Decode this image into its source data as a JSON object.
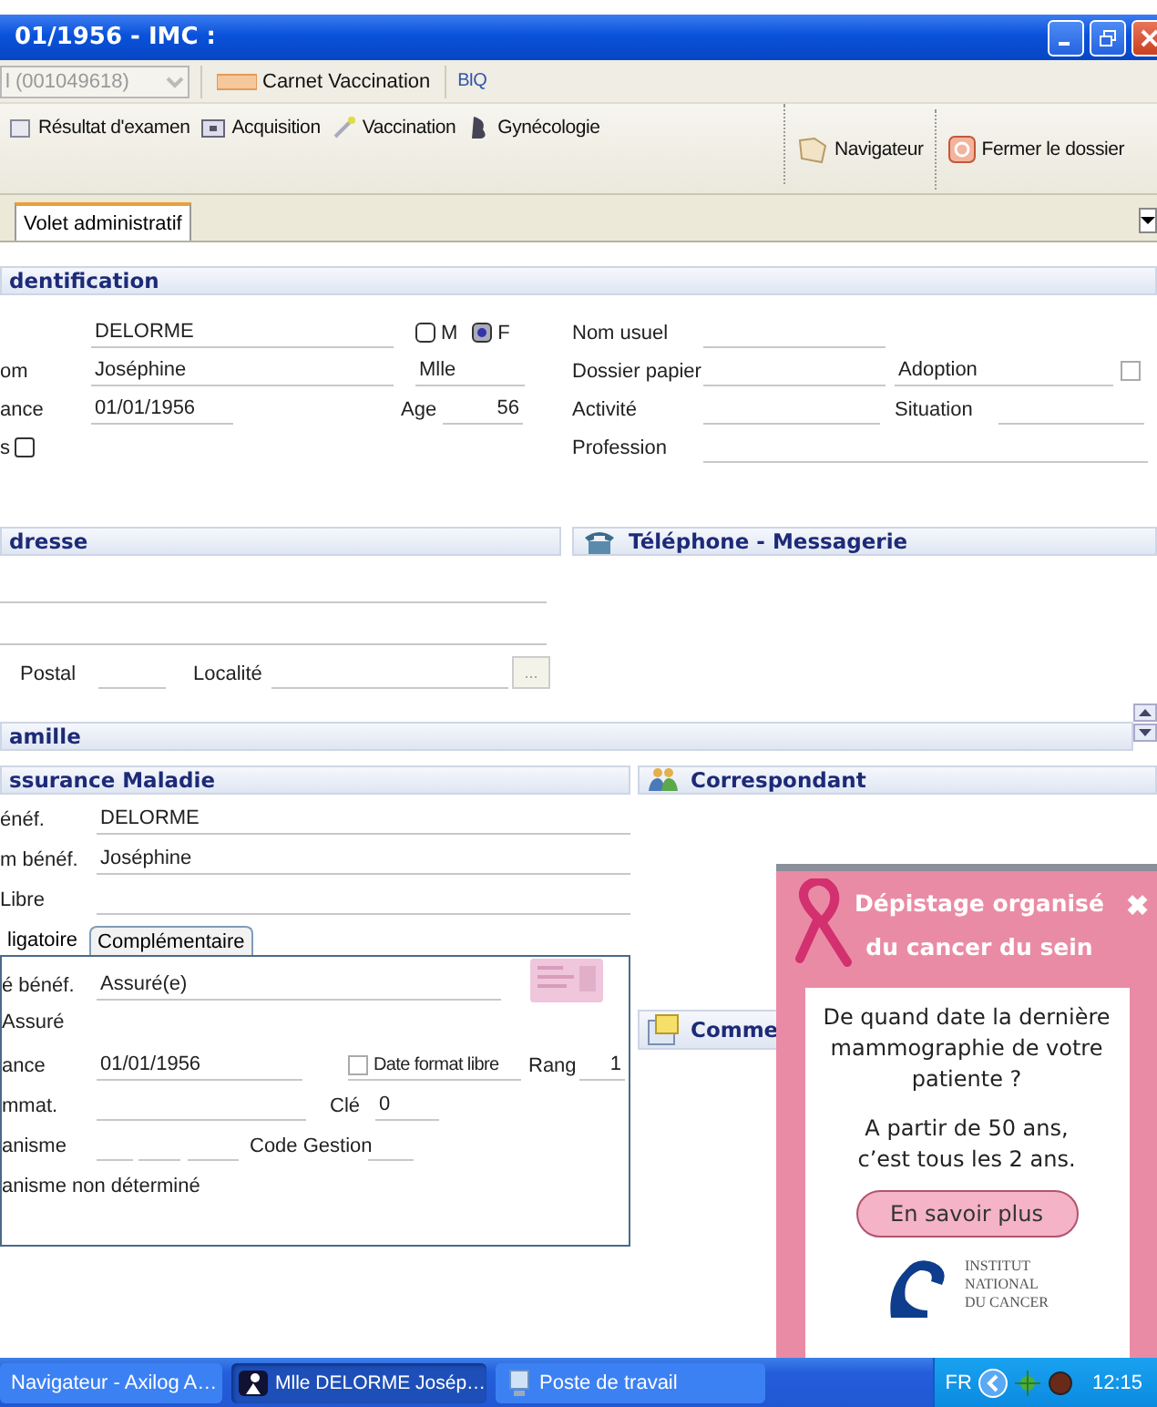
{
  "window": {
    "title": "01/1956 - IMC :"
  },
  "patient_combo": {
    "value": "l (001049618)"
  },
  "top_toolbar": {
    "vaccination_book": "Carnet Vaccination",
    "logo": "BIQ"
  },
  "toolbar": {
    "left": [
      "Résultat d'examen",
      "Acquisition",
      "Vaccination",
      "Gynécologie"
    ],
    "right": [
      "Navigateur",
      "Fermer le dossier"
    ]
  },
  "tabs": [
    {
      "label": "Volet administratif",
      "selected": true
    }
  ],
  "identification": {
    "title": "dentification",
    "last_name": "DELORME",
    "sex": [
      {
        "label": "M",
        "selected": false
      },
      {
        "label": "F",
        "selected": true
      }
    ],
    "first_name": {
      "label": "om",
      "value": "Joséphine"
    },
    "civility": "Mlle",
    "birth_date": {
      "label": "ance",
      "value": "01/01/1956"
    },
    "age": {
      "label": "Age",
      "value": "56"
    },
    "flag": {
      "label": "s",
      "checked": false
    },
    "usual_name": {
      "label": "Nom usuel"
    },
    "paper_file": {
      "label": "Dossier papier"
    },
    "adoption": {
      "label": "Adoption",
      "checked": false
    },
    "activity": {
      "label": "Activité"
    },
    "situation": {
      "label": "Situation"
    },
    "profession": {
      "label": "Profession"
    }
  },
  "address": {
    "title": "dresse",
    "postal": {
      "label": "Postal"
    },
    "city": {
      "label": "Localité"
    },
    "lookup_button": "..."
  },
  "phone": {
    "title": "Téléphone - Messagerie"
  },
  "family": {
    "title": "amille"
  },
  "insurance": {
    "title": "ssurance Maladie",
    "rows": [
      {
        "label": "énéf.",
        "value": "DELORME"
      },
      {
        "label": "m bénéf.",
        "value": "Joséphine"
      },
      {
        "label": "Libre"
      }
    ],
    "subtabs": [
      {
        "label": "ligatoire",
        "selected": true
      },
      {
        "label": "Complémentaire",
        "selected": false
      }
    ],
    "quality": {
      "label": "é bénéf.",
      "value": "Assuré(e)"
    },
    "insured_label": "Assuré",
    "birth_date": {
      "label": "ance",
      "value": "01/01/1956"
    },
    "free_date": {
      "label": "Date format libre",
      "checked": false
    },
    "rank": {
      "label": "Rang",
      "value": "1"
    },
    "registration": {
      "label": "mmat."
    },
    "key": {
      "label": "Clé",
      "value": "0"
    },
    "organism": {
      "label": "anisme"
    },
    "management_code": {
      "label": "Code Gestion"
    },
    "organism_note": "anisme non déterminé"
  },
  "correspondent": {
    "title": "Correspondant"
  },
  "comment": {
    "title": "Comme"
  },
  "popup": {
    "title": "Dépistage organisé du cancer du sein",
    "close": "✖",
    "question": "De quand date la dernière mammographie de votre patiente ?",
    "advice": "A partir de 50 ans, c’est tous les 2 ans.",
    "button": "En savoir plus",
    "logo_lines": [
      "INSTITUT",
      "NATIONAL",
      "DU CANCER"
    ]
  },
  "taskbar": {
    "items": [
      {
        "label": "Navigateur - Axilog A…",
        "selected": false
      },
      {
        "label": "Mlle DELORME Josép…",
        "selected": true
      },
      {
        "label": "Poste de travail",
        "selected": false
      }
    ],
    "language": "FR",
    "clock": "12:15"
  }
}
